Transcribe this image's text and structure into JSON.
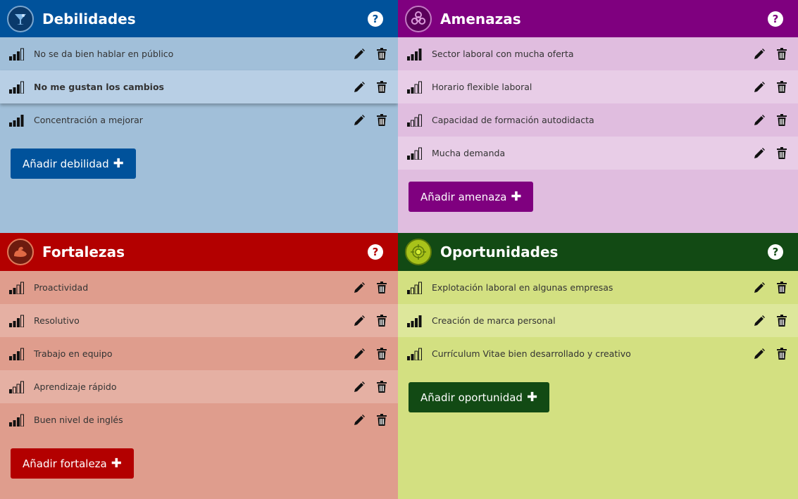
{
  "colors": {
    "debilidades": "#00529b",
    "amenazas": "#7f007f",
    "fortalezas": "#b30000",
    "oportunidades": "#124a14"
  },
  "debilidades": {
    "title": "Debilidades",
    "logo_icon": "cocktail-glass-icon",
    "help": "?",
    "items": [
      {
        "label": "No se da bien hablar en público",
        "level": 3
      },
      {
        "label": "No me gustan los cambios",
        "level": 3
      },
      {
        "label": "Concentración a mejorar",
        "level": 4
      }
    ],
    "add_label": "Añadir debilidad"
  },
  "amenazas": {
    "title": "Amenazas",
    "logo_icon": "biohazard-icon",
    "help": "?",
    "items": [
      {
        "label": "Sector laboral con mucha oferta",
        "level": 4
      },
      {
        "label": "Horario flexible laboral",
        "level": 2
      },
      {
        "label": "Capacidad de formación autodidacta",
        "level": 1
      },
      {
        "label": "Mucha demanda",
        "level": 2
      }
    ],
    "add_label": "Añadir amenaza"
  },
  "fortalezas": {
    "title": "Fortalezas",
    "logo_icon": "flexed-arm-icon",
    "help": "?",
    "items": [
      {
        "label": "Proactividad",
        "level": 2
      },
      {
        "label": "Resolutivo",
        "level": 3
      },
      {
        "label": "Trabajo en equipo",
        "level": 3
      },
      {
        "label": "Aprendizaje rápido",
        "level": 1
      },
      {
        "label": "Buen nivel de inglés",
        "level": 3
      }
    ],
    "add_label": "Añadir fortaleza"
  },
  "oportunidades": {
    "title": "Oportunidades",
    "logo_icon": "target-icon",
    "help": "?",
    "items": [
      {
        "label": "Explotación laboral en algunas empresas",
        "level": 1
      },
      {
        "label": "Creación de marca personal",
        "level": 4
      },
      {
        "label": "Currículum Vitae bien desarrollado y creativo",
        "level": 2
      }
    ],
    "add_label": "Añadir oportunidad"
  }
}
